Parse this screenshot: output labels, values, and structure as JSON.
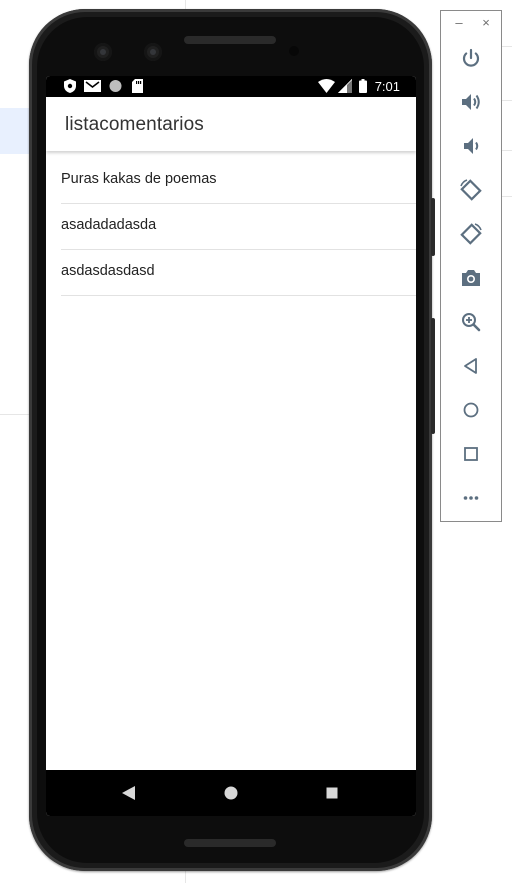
{
  "status_bar": {
    "time": "7:01"
  },
  "app": {
    "title": "listacomentarios"
  },
  "comments": [
    "Puras kakas de poemas",
    "asadadadasda",
    "asdasdasdasd"
  ],
  "emulator_panel": {
    "window_controls": [
      "–",
      "×"
    ],
    "tools": [
      "power-icon",
      "volume-up-icon",
      "volume-down-icon",
      "rotate-left-icon",
      "rotate-right-icon",
      "camera-icon",
      "zoom-icon",
      "back-icon",
      "home-icon",
      "overview-icon",
      "more-icon"
    ]
  },
  "colors": {
    "icon": "#5c6f80",
    "appbar_text": "#333333"
  }
}
